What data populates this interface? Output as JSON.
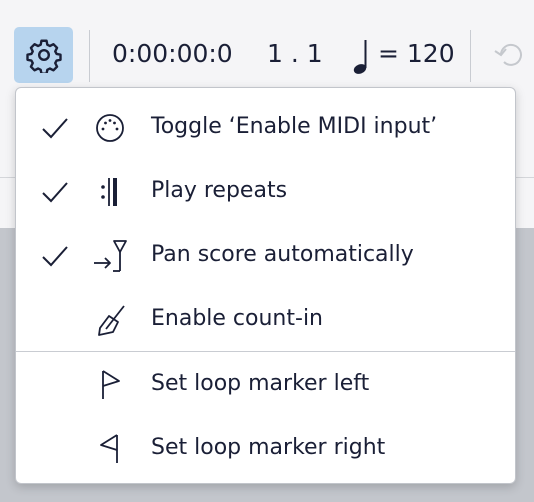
{
  "toolbar": {
    "settings_icon": "gear-icon",
    "time": "0:00:00:0",
    "measure": "1 . 1",
    "tempo_note_icon": "quarter-note-icon",
    "tempo": "= 120",
    "undo_icon": "undo-icon"
  },
  "menu": {
    "items": [
      {
        "label": "Toggle ‘Enable MIDI input’",
        "checked": true,
        "icon": "midi-port-icon"
      },
      {
        "label": "Play repeats",
        "checked": true,
        "icon": "repeat-barline-icon"
      },
      {
        "label": "Pan score automatically",
        "checked": true,
        "icon": "pan-score-icon"
      },
      {
        "label": "Enable count-in",
        "checked": false,
        "icon": "metronome-icon"
      },
      {
        "label": "Set loop marker left",
        "checked": false,
        "icon": "loop-marker-left-icon"
      },
      {
        "label": "Set loop marker right",
        "checked": false,
        "icon": "loop-marker-right-icon"
      }
    ]
  },
  "colors": {
    "accent": "#b7d4ee",
    "text": "#1a1f36",
    "menu_bg": "#ffffff",
    "backdrop": "#c3c6cc"
  }
}
